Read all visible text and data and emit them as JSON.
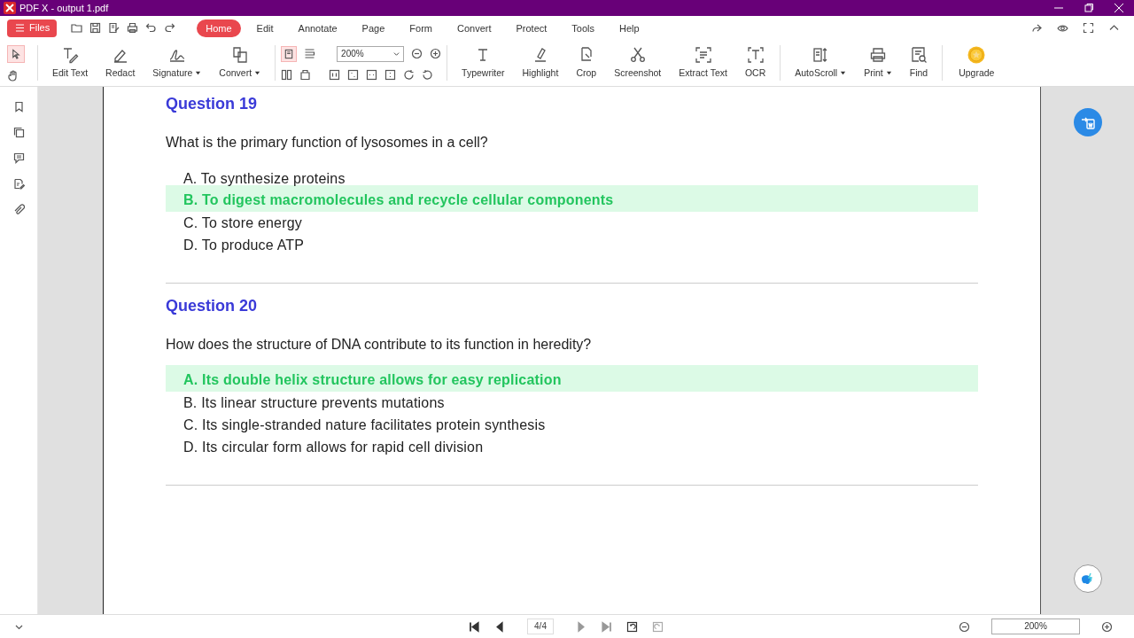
{
  "window": {
    "title": "PDF X - output 1.pdf"
  },
  "files_button": {
    "label": "Files"
  },
  "menu_tabs": [
    {
      "label": "Home",
      "selected": true
    },
    {
      "label": "Edit",
      "selected": false
    },
    {
      "label": "Annotate",
      "selected": false
    },
    {
      "label": "Page",
      "selected": false
    },
    {
      "label": "Form",
      "selected": false
    },
    {
      "label": "Convert",
      "selected": false
    },
    {
      "label": "Protect",
      "selected": false
    },
    {
      "label": "Tools",
      "selected": false
    },
    {
      "label": "Help",
      "selected": false
    }
  ],
  "tools_left": [
    {
      "label": "Edit Text",
      "dropdown": false
    },
    {
      "label": "Redact",
      "dropdown": false
    },
    {
      "label": "Signature",
      "dropdown": true
    },
    {
      "label": "Convert",
      "dropdown": true
    }
  ],
  "zoom_select": {
    "value": "200%"
  },
  "tools_right": [
    {
      "label": "Typewriter",
      "dropdown": false
    },
    {
      "label": "Highlight",
      "dropdown": false
    },
    {
      "label": "Crop",
      "dropdown": false
    },
    {
      "label": "Screenshot",
      "dropdown": false
    },
    {
      "label": "Extract Text",
      "dropdown": false
    },
    {
      "label": "OCR",
      "dropdown": false
    }
  ],
  "tools_extra": [
    {
      "label": "AutoScroll",
      "dropdown": true
    },
    {
      "label": "Print",
      "dropdown": true
    },
    {
      "label": "Find",
      "dropdown": false
    }
  ],
  "upgrade": {
    "label": "Upgrade"
  },
  "questions": [
    {
      "title": "Question 19",
      "question": "What is the primary function of lysosomes in a cell?",
      "options": [
        {
          "text": "A. To synthesize proteins",
          "correct": false
        },
        {
          "text": "B. To digest macromolecules and recycle cellular components",
          "correct": true
        },
        {
          "text": "C. To store energy",
          "correct": false
        },
        {
          "text": "D. To produce ATP",
          "correct": false
        }
      ]
    },
    {
      "title": "Question 20",
      "question": "How does the structure of DNA contribute to its function in heredity?",
      "options": [
        {
          "text": "A. Its double helix structure allows for easy replication",
          "correct": true
        },
        {
          "text": "B. Its linear structure prevents mutations",
          "correct": false
        },
        {
          "text": "C. Its single-stranded nature facilitates protein synthesis",
          "correct": false
        },
        {
          "text": "D. Its circular form allows for rapid cell division",
          "correct": false
        }
      ]
    }
  ],
  "status_bar": {
    "page": "4/4",
    "zoom": "200%"
  }
}
